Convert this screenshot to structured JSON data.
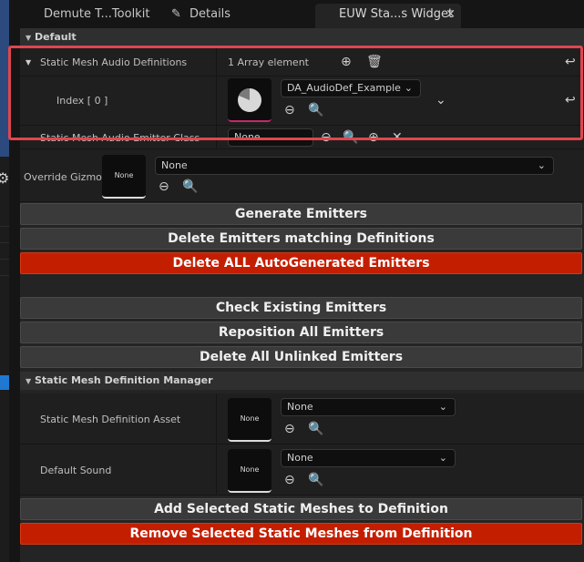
{
  "tabs": [
    {
      "label": "Demute T...Toolkit"
    },
    {
      "label": "Details"
    },
    {
      "label": "EUW Sta...s Widget",
      "close": "×"
    }
  ],
  "categories": {
    "default": "Default",
    "manager": "Static Mesh Definition Manager"
  },
  "defaults": {
    "audio_definitions": {
      "label": "Static Mesh Audio Definitions",
      "value": "1 Array element"
    },
    "index": {
      "label": "Index [ 0 ]",
      "asset": "DA_AudioDef_Example"
    },
    "emitter_class": {
      "label": "Static Mesh Audio Emitter Class",
      "value": "None"
    },
    "override_gizmo": {
      "label": "Override Gizmo",
      "thumb": "None",
      "value": "None"
    }
  },
  "buttons": {
    "generate": "Generate Emitters",
    "delete_matching": "Delete Emitters matching Definitions",
    "delete_all_auto": "Delete ALL AutoGenerated Emitters",
    "check_existing": "Check Existing Emitters",
    "reposition_all": "Reposition All Emitters",
    "delete_unlinked": "Delete All Unlinked Emitters",
    "add_selected": "Add Selected Static Meshes to Definition",
    "remove_selected": "Remove Selected Static Meshes from Definition"
  },
  "manager": {
    "definition_asset": {
      "label": "Static Mesh Definition Asset",
      "thumb": "None",
      "value": "None"
    },
    "default_sound": {
      "label": "Default Sound",
      "thumb": "None",
      "value": "None"
    }
  },
  "icons": {
    "tab_details": "pencil-icon",
    "add": "plus-circle-icon",
    "delete": "trash-icon",
    "reset": "reset-arrow-icon",
    "use_selected": "arrow-left-circle-icon",
    "browse": "browse-folder-icon",
    "settings": "gear-icon"
  },
  "colors": {
    "panel": "#242424",
    "button": "#3a3a3a",
    "danger": "#c41e00",
    "highlight": "#e0464e",
    "asset_underline": "#c4286a"
  }
}
